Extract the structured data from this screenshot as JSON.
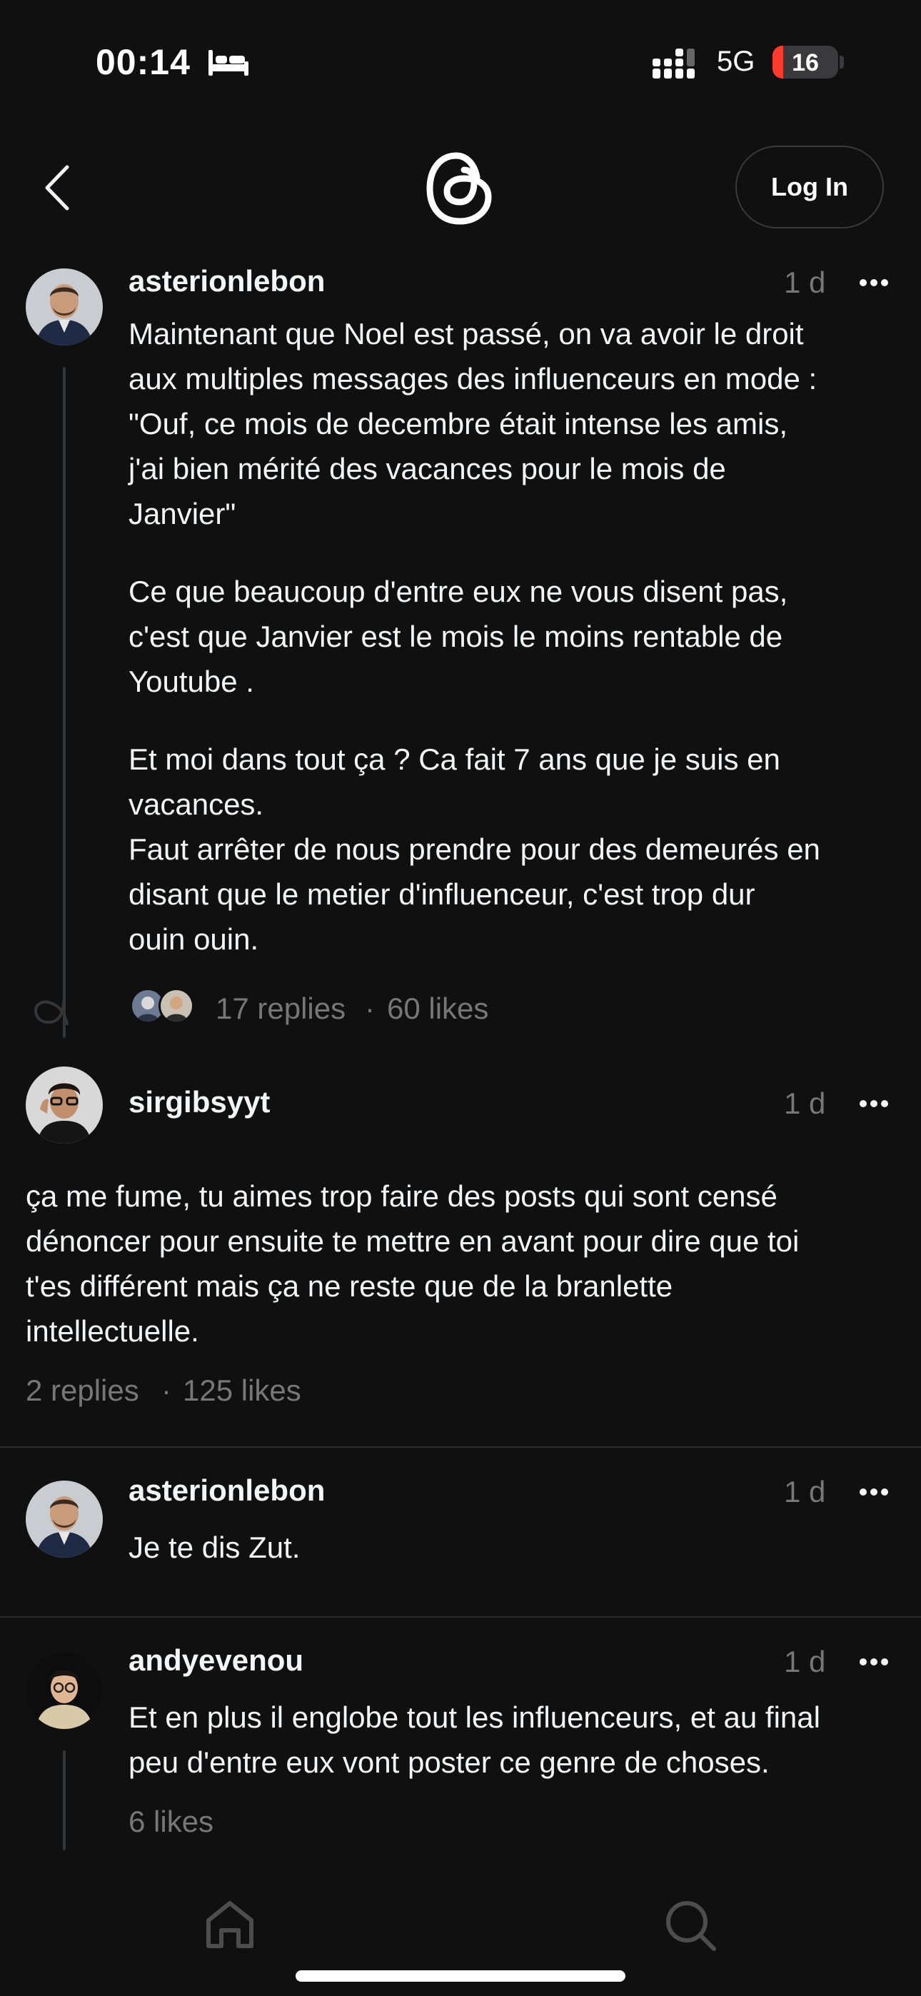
{
  "status_bar": {
    "time": "00:14",
    "network": "5G",
    "battery": "16",
    "battery_level_percent": 16,
    "icons": [
      "bed-icon",
      "signal-icon",
      "battery-icon"
    ]
  },
  "header": {
    "back_icon": "chevron-left-icon",
    "logo_icon": "threads-logo-icon",
    "login_label": "Log In"
  },
  "posts": [
    {
      "username": "asterionlebon",
      "time": "1 d",
      "paragraphs": [
        "Maintenant que Noel est passé, on va avoir le droit\naux multiples messages des influenceurs en mode :\n\"Ouf, ce mois de decembre était intense les amis,\nj'ai bien mérité des vacances pour le mois de\nJanvier\"",
        "Ce que beaucoup d'entre eux ne vous disent pas,\nc'est que Janvier est le mois le moins rentable de\nYoutube .",
        "Et moi dans tout ça ? Ca fait 7 ans que je suis en\nvacances.\nFaut arrêter de nous prendre pour des demeurés en\ndisant que le metier d'influenceur, c'est trop dur\nouin ouin."
      ],
      "replies": "17 replies",
      "separator": "·",
      "likes": "60 likes"
    },
    {
      "username": "sirgibsyyt",
      "time": "1 d",
      "text": "ça me fume, tu aimes trop faire des posts qui sont censé\ndénoncer pour ensuite te mettre en avant pour dire que toi\nt'es différent mais ça ne reste que de la branlette\nintellectuelle.",
      "replies": "2 replies",
      "separator": "·",
      "likes": "125 likes"
    },
    {
      "username": "asterionlebon",
      "time": "1 d",
      "text": "Je te dis Zut."
    },
    {
      "username": "andyevenou",
      "time": "1 d",
      "text": "Et en plus il englobe tout les influenceurs, et au final\npeu d'entre eux vont poster ce genre de choses.",
      "likes": "6 likes"
    }
  ],
  "bottom_nav": {
    "items": [
      "home-icon",
      "search-icon"
    ]
  },
  "colors": {
    "background": "#101010",
    "text": "#f3f5f7",
    "secondary_text": "#777777",
    "divider": "#2a2a2a",
    "battery_low": "#ff3b30"
  }
}
